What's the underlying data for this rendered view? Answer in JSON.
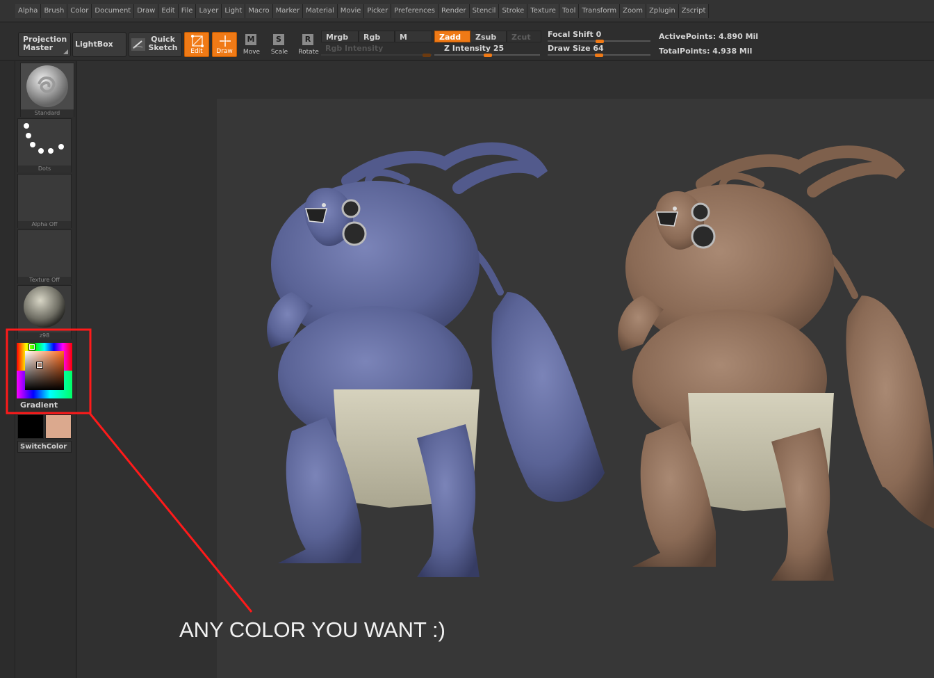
{
  "menu": [
    "Alpha",
    "Brush",
    "Color",
    "Document",
    "Draw",
    "Edit",
    "File",
    "Layer",
    "Light",
    "Macro",
    "Marker",
    "Material",
    "Movie",
    "Picker",
    "Preferences",
    "Render",
    "Stencil",
    "Stroke",
    "Texture",
    "Tool",
    "Transform",
    "Zoom",
    "Zplugin",
    "Zscript"
  ],
  "toolbar": {
    "projection_master_1": "Projection",
    "projection_master_2": "Master",
    "lightbox": "LightBox",
    "quick_sketch_1": "Quick",
    "quick_sketch_2": "Sketch",
    "edit": "Edit",
    "draw": "Draw",
    "move": "Move",
    "scale": "Scale",
    "rotate": "Rotate",
    "move_glyph": "M",
    "scale_glyph": "S",
    "rotate_glyph": "R",
    "mrgb": "Mrgb",
    "rgb": "Rgb",
    "m": "M",
    "rgb_intensity": "Rgb Intensity",
    "zadd": "Zadd",
    "zsub": "Zsub",
    "zcut": "Zcut",
    "z_intensity_label": "Z Intensity",
    "z_intensity_value": "25",
    "focal_shift_label": "Focal Shift",
    "focal_shift_value": "0",
    "draw_size_label": "Draw Size",
    "draw_size_value": "64",
    "active_points": "ActivePoints: 4.890 Mil",
    "total_points": "TotalPoints: 4.938 Mil"
  },
  "shelf": {
    "brush": "Standard",
    "stroke": "Dots",
    "alpha": "Alpha Off",
    "texture": "Texture Off",
    "material": "z98",
    "gradient": "Gradient",
    "switch_color": "SwitchColor"
  },
  "annotation": "ANY COLOR YOU WANT :)",
  "colors": {
    "accent": "#f07a16",
    "highlight_box": "#ff1a1a",
    "main_color": "#000000",
    "secondary_color": "#dba98e",
    "blue_model": "#5a6396",
    "brown_model": "#8a6a55"
  }
}
